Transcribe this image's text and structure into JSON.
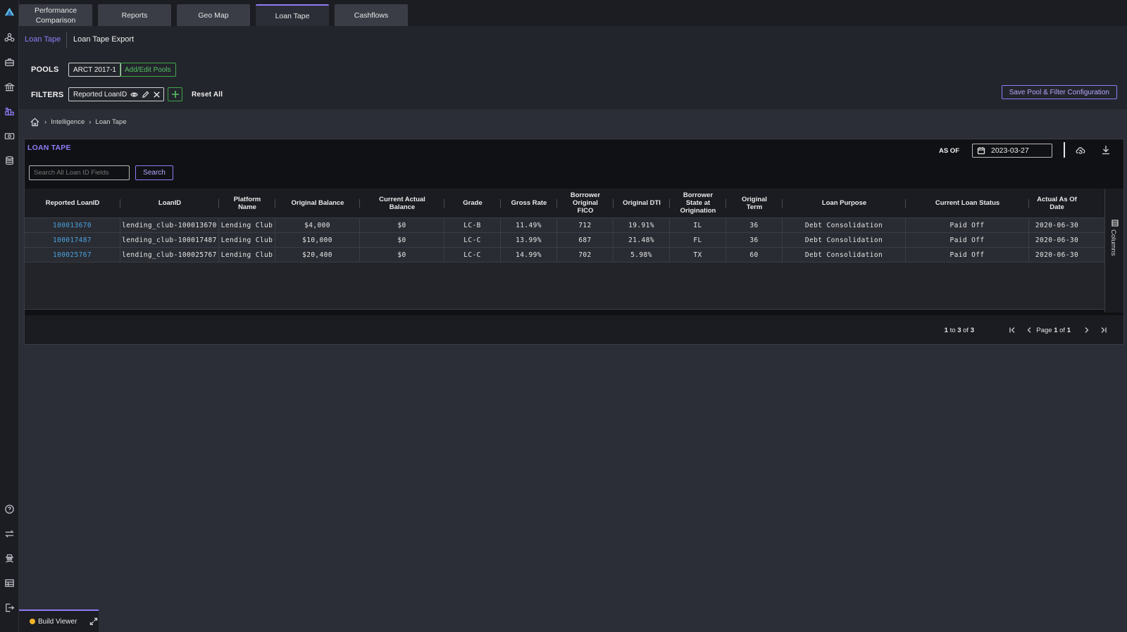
{
  "tabs": [
    {
      "label": "Performance\nComparison"
    },
    {
      "label": "Reports"
    },
    {
      "label": "Geo Map"
    },
    {
      "label": "Loan Tape"
    },
    {
      "label": "Cashflows"
    }
  ],
  "subnav": {
    "link1": "Loan Tape",
    "link2": "Loan Tape Export"
  },
  "pools": {
    "label": "POOLS",
    "selected": "ARCT 2017-1",
    "add_edit": "Add/Edit Pools"
  },
  "filters": {
    "label": "FILTERS",
    "chip": "Reported LoanID",
    "reset": "Reset All"
  },
  "save_config": "Save Pool & Filter Configuration",
  "breadcrumb": {
    "item1": "Intelligence",
    "item2": "Loan Tape"
  },
  "panel": {
    "title": "LOAN TAPE",
    "search_placeholder": "Search All Loan ID Fields",
    "search_button": "Search",
    "as_of_label": "AS OF",
    "as_of_date": "2023-03-27"
  },
  "table": {
    "columns": [
      "Reported LoanID",
      "LoanID",
      "Platform Name",
      "Original Balance",
      "Current Actual Balance",
      "Grade",
      "Gross Rate",
      "Borrower Original FICO",
      "Original DTI",
      "Borrower State at Origination",
      "Original Term",
      "Loan Purpose",
      "Current Loan Status",
      "Actual As Of Date"
    ],
    "rows": [
      [
        "100013670",
        "lending_club-100013670",
        "Lending Club",
        "$4,000",
        "$0",
        "LC-B",
        "11.49%",
        "712",
        "19.91%",
        "IL",
        "36",
        "Debt Consolidation",
        "Paid Off",
        "2020-06-30"
      ],
      [
        "100017487",
        "lending_club-100017487",
        "Lending Club",
        "$10,000",
        "$0",
        "LC-C",
        "13.99%",
        "687",
        "21.48%",
        "FL",
        "36",
        "Debt Consolidation",
        "Paid Off",
        "2020-06-30"
      ],
      [
        "100025767",
        "lending_club-100025767",
        "Lending Club",
        "$20,400",
        "$0",
        "LC-C",
        "14.99%",
        "702",
        "5.98%",
        "TX",
        "60",
        "Debt Consolidation",
        "Paid Off",
        "2020-06-30"
      ]
    ],
    "columns_toggle": "Columns"
  },
  "pager": {
    "from": "1",
    "to_label": "to",
    "to": "3",
    "of_label": "of",
    "total": "3",
    "page_label": "Page",
    "page": "1",
    "page_of": "of",
    "pages": "1"
  },
  "build_viewer": "Build Viewer",
  "colors": {
    "accent": "#8f7cf7",
    "green": "#3fa64a",
    "link": "#4aa3df",
    "status_dot": "#f0b429"
  }
}
